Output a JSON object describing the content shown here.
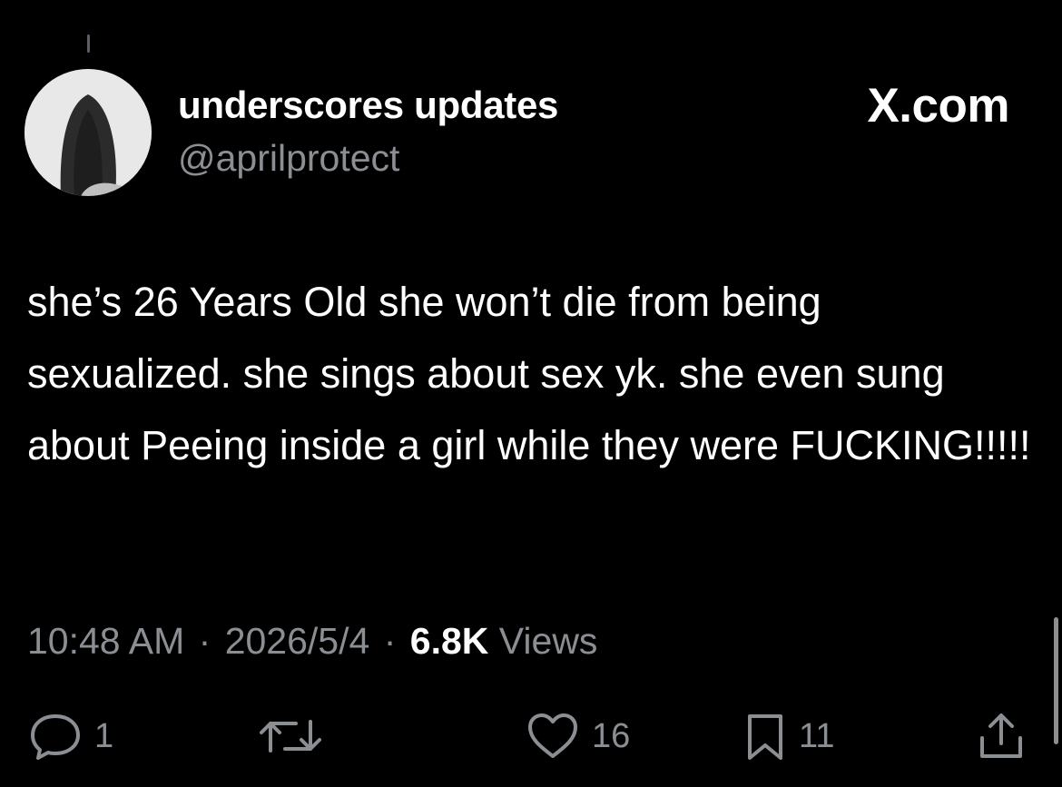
{
  "author": {
    "display_name": "underscores updates",
    "handle": "@aprilprotect"
  },
  "source": {
    "label": "X.com"
  },
  "tweet": {
    "text": "she’s 26 Years Old she won’t die from being sexualized. she sings about sex yk. she even sung about Peeing inside a girl while they were FUCKING!!!!!"
  },
  "meta": {
    "time": "10:48 AM",
    "separator": "·",
    "date": "2026/5/4",
    "views_count": "6.8K",
    "views_label": "Views"
  },
  "actions": {
    "reply": {
      "icon": "reply-icon",
      "count": "1"
    },
    "repost": {
      "icon": "repost-icon",
      "count": ""
    },
    "like": {
      "icon": "heart-icon",
      "count": "16"
    },
    "bookmark": {
      "icon": "bookmark-icon",
      "count": "11"
    },
    "share": {
      "icon": "share-icon"
    }
  },
  "colors": {
    "background": "#000000",
    "text_primary": "#ffffff",
    "text_secondary": "#8b8f94"
  }
}
